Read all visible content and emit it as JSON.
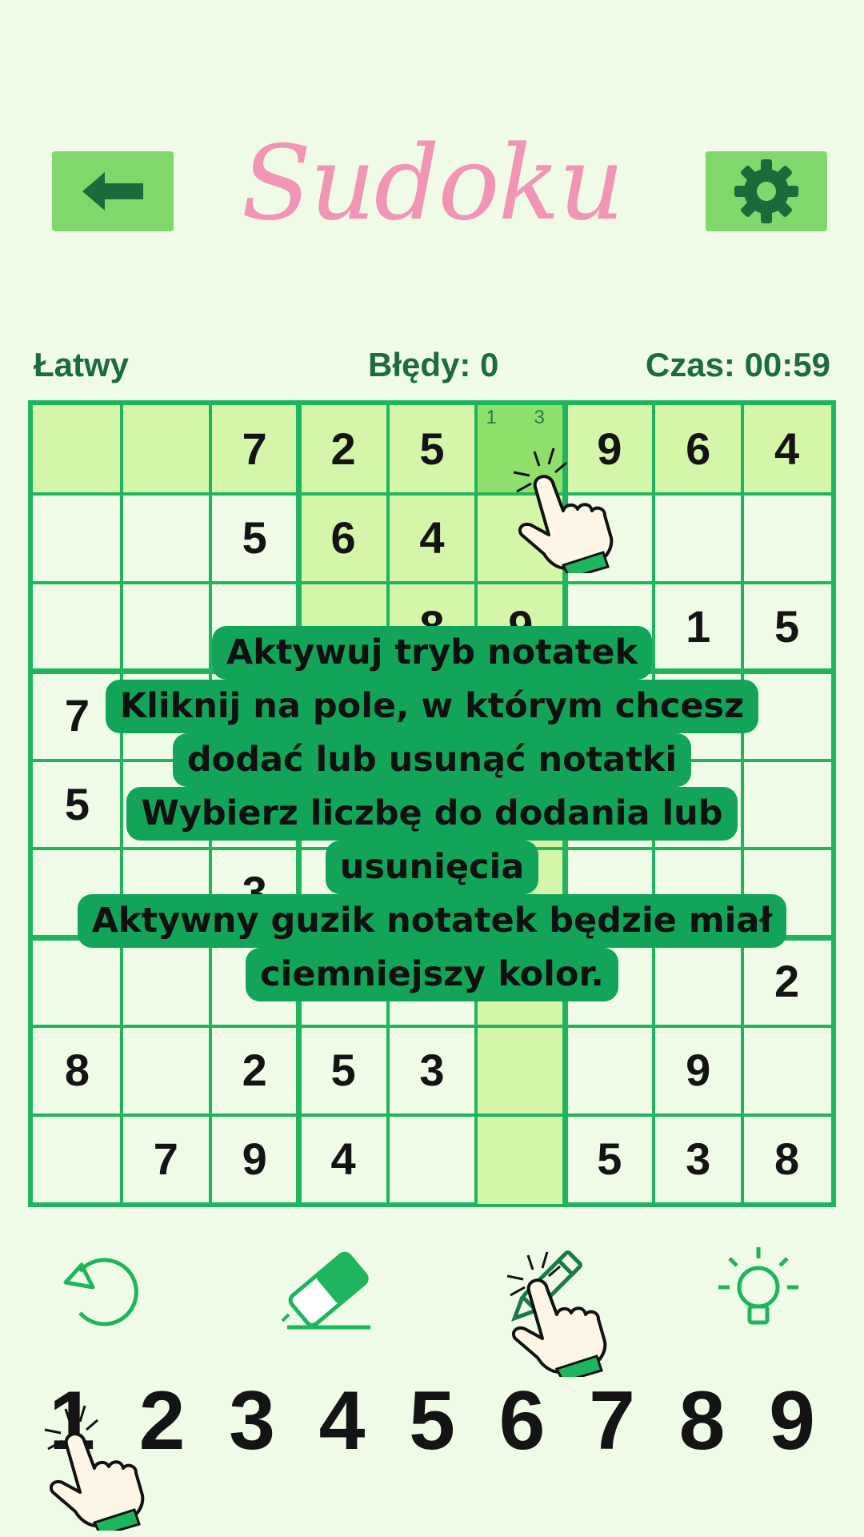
{
  "header": {
    "title": "Sudoku",
    "back_icon": "arrow-left-icon",
    "settings_icon": "gear-icon"
  },
  "status": {
    "difficulty": "Łatwy",
    "mistakes": "Błędy: 0",
    "timer": "Czas: 00:59"
  },
  "board": {
    "selected_cell": [
      0,
      5
    ],
    "selected_notes": [
      "1",
      "3"
    ],
    "rows": [
      [
        "",
        "",
        "7",
        "2",
        "5",
        "",
        "9",
        "6",
        "4"
      ],
      [
        "",
        "",
        "5",
        "6",
        "4",
        "",
        "",
        "",
        ""
      ],
      [
        "",
        "",
        "",
        "",
        "8",
        "9",
        "",
        "1",
        "5"
      ],
      [
        "7",
        "",
        "",
        "",
        "",
        "",
        "",
        "",
        ""
      ],
      [
        "5",
        "",
        "",
        "",
        "",
        "",
        "",
        "",
        ""
      ],
      [
        "",
        "",
        "3",
        "",
        "",
        "",
        "",
        "",
        ""
      ],
      [
        "",
        "",
        "",
        "",
        "",
        "",
        "",
        "",
        "2"
      ],
      [
        "8",
        "",
        "2",
        "5",
        "3",
        "",
        "",
        "9",
        ""
      ],
      [
        "",
        "7",
        "9",
        "4",
        "",
        "",
        "5",
        "3",
        "8"
      ]
    ]
  },
  "tutorial": {
    "lines": [
      "Aktywuj tryb notatek",
      "Kliknij na pole, w którym chcesz",
      "dodać lub usunąć notatki",
      "Wybierz liczbę do dodania lub",
      "usunięcia",
      "Aktywny guzik notatek będzie miał",
      "ciemniejszy kolor."
    ]
  },
  "toolbar": {
    "undo_icon": "undo-icon",
    "erase_icon": "eraser-icon",
    "notes_icon": "pencil-icon",
    "hint_icon": "lightbulb-icon"
  },
  "numpad": [
    "1",
    "2",
    "3",
    "4",
    "5",
    "6",
    "7",
    "8",
    "9"
  ],
  "colors": {
    "background": "#effbe6",
    "accent": "#1eb55e",
    "button": "#7ed86a",
    "title": "#f294b4",
    "status_text": "#1e6b3f",
    "highlight_light": "#d5f5a8",
    "highlight_selected": "#8ee06a",
    "tooltip": "#12a55a"
  }
}
